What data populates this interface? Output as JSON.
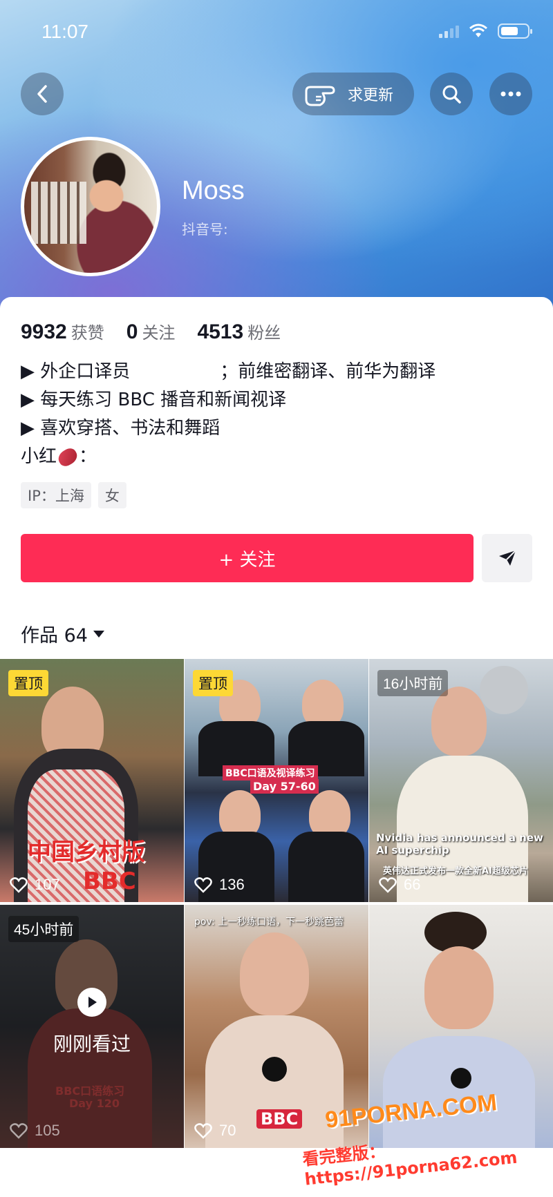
{
  "status_bar": {
    "time": "11:07"
  },
  "header": {
    "update_label": "求更新"
  },
  "profile": {
    "name": "Moss",
    "douyin_id_label": "抖音号:",
    "stats": [
      {
        "value": "9932",
        "label": "获赞"
      },
      {
        "value": "0",
        "label": "关注"
      },
      {
        "value": "4513",
        "label": "粉丝"
      }
    ],
    "bio": {
      "line1_a": "▶ 外企口译员",
      "line1_b": "；前维密翻译、前华为翻译",
      "line2": "▶ 每天练习 BBC 播音和新闻视译",
      "line3": "▶ 喜欢穿搭、书法和舞蹈",
      "line4_a": "小红",
      "line4_b": "："
    },
    "tags": [
      "IP：上海",
      "女"
    ],
    "follow_label": "+ 关注"
  },
  "works": {
    "label": "作品 64",
    "items": [
      {
        "badge": "置顶",
        "badge_type": "pinned",
        "likes": "107",
        "text": "中国乡村版",
        "text2": "BBC"
      },
      {
        "badge": "置顶",
        "badge_type": "pinned",
        "likes": "136",
        "text": "BBC口语及视译练习",
        "text2": "Day 57-60"
      },
      {
        "badge": "16小时前",
        "badge_type": "time",
        "likes": "66",
        "text": "Nvidia has announced a new AI superchip",
        "text2": "英伟达正式发布一款全新AI超级芯片"
      },
      {
        "badge": "45小时前",
        "badge_type": "time",
        "likes": "105",
        "watched": "刚刚看过",
        "text": "BBC口语练习",
        "text2": "Day 120"
      },
      {
        "badge": "",
        "likes": "70",
        "text": "pov: 上一秒练口语，下一秒跳芭蕾",
        "text2": "BBC"
      },
      {
        "badge": "",
        "likes": "",
        "text": "",
        "text2": ""
      }
    ]
  },
  "watermark": {
    "line1": "91PORNA.COM",
    "line2": "看完整版：https://91porna62.com"
  }
}
